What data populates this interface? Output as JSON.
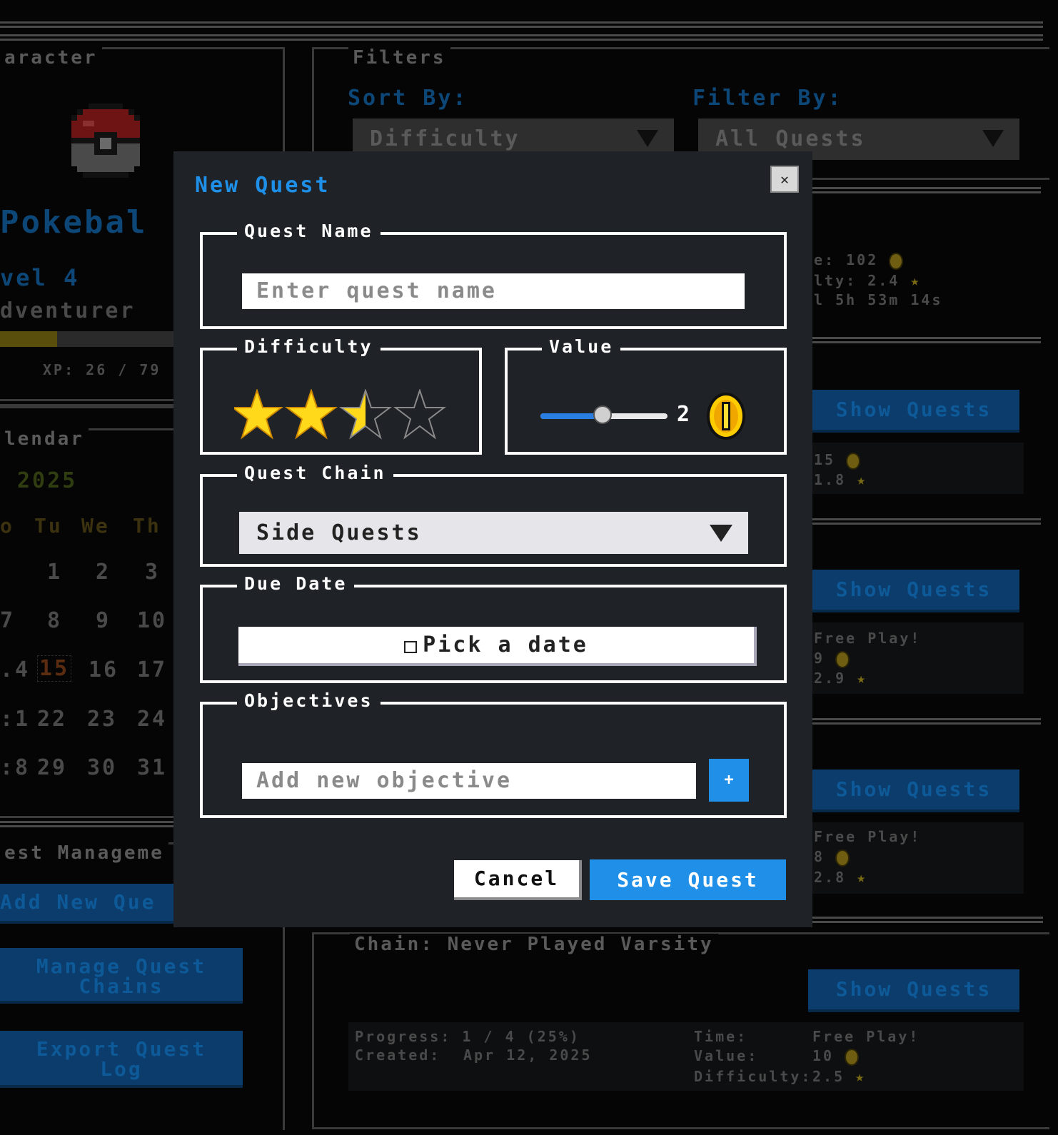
{
  "background": {
    "character": {
      "panel_title": "aracter",
      "name": "Pokebal",
      "level": "vel 4",
      "class": "dventurer",
      "xp": "XP: 26 / 79",
      "xp_progress": 0.33
    },
    "calendar": {
      "panel_title": "lendar",
      "year": "2025",
      "weekdays": [
        "o",
        "Tu",
        "We",
        "Th"
      ],
      "rows": [
        [
          "",
          "1",
          "2",
          "3"
        ],
        [
          "7",
          "8",
          "9",
          "10"
        ],
        [
          ".4",
          "15",
          "16",
          "17"
        ],
        [
          ":1",
          "22",
          "23",
          "24"
        ],
        [
          ":8",
          "29",
          "30",
          "31"
        ]
      ],
      "today": "15"
    },
    "quest_management": {
      "panel_title": "est Manageme",
      "add_new": "Add New Que",
      "manage_chains": [
        "Manage Quest",
        "Chains"
      ],
      "export_log": [
        "Export Quest",
        "Log"
      ]
    },
    "filters": {
      "panel_title": "Filters",
      "sort_label": "Sort By:",
      "sort_value": "Difficulty",
      "filter_label": "Filter By:",
      "filter_value": "All Quests"
    },
    "chains": [
      {
        "stats": [
          "e: 102",
          "lty: 2.4",
          "l 5h 53m 14s"
        ]
      },
      {
        "show": "Show Quests",
        "stats": [
          "15",
          "1.8"
        ]
      },
      {
        "show": "Show Quests",
        "stats": [
          "Free Play!",
          "9",
          "2.9"
        ]
      },
      {
        "show": "Show Quests",
        "stats": [
          "Free Play!",
          "8",
          "2.8"
        ]
      },
      {
        "title": "Chain: Never Played Varsity",
        "show": "Show Quests",
        "progress": "Progress: 1 / 4 (25%)",
        "created_label": "Created:",
        "created_value": "Apr 12, 2025",
        "time_label": "Time:",
        "time_value": "Free Play!",
        "value_label": "Value:",
        "value_value": "10",
        "difficulty_label": "Difficulty:",
        "difficulty_value": "2.5"
      }
    ]
  },
  "modal": {
    "title": "New Quest",
    "close_icon": "close-icon",
    "quest_name": {
      "legend": "Quest Name",
      "placeholder": "Enter quest name"
    },
    "difficulty": {
      "legend": "Difficulty",
      "rating": 2.5,
      "max": 4
    },
    "value": {
      "legend": "Value",
      "number": "2",
      "slider_fraction": 0.5
    },
    "quest_chain": {
      "legend": "Quest Chain",
      "selected": "Side Quests"
    },
    "due_date": {
      "legend": "Due Date",
      "button": "Pick a date",
      "icon": "calendar-icon"
    },
    "objectives": {
      "legend": "Objectives",
      "placeholder": "Add new objective",
      "add_label": "+"
    },
    "cancel": "Cancel",
    "save": "Save Quest"
  },
  "colors": {
    "accent": "#1f8fe8",
    "modal_bg": "#1f2227",
    "star_gold": "#ffd91a",
    "coin_gold": "#ffcc00"
  }
}
